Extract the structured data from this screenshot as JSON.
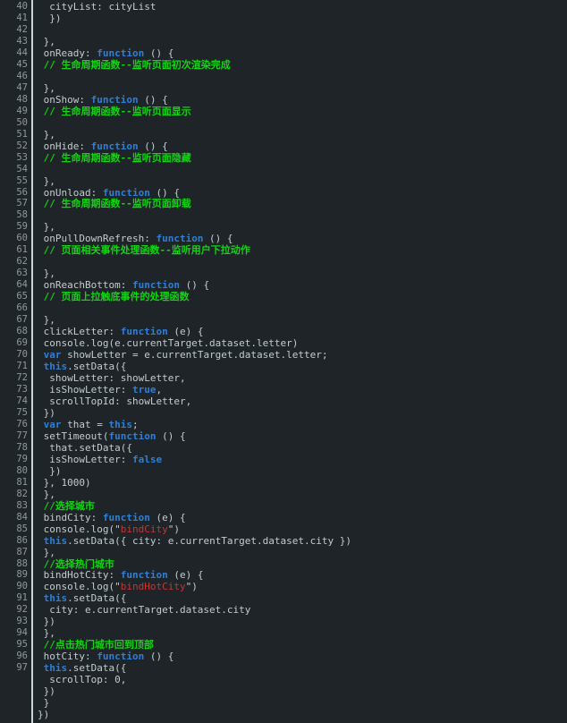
{
  "editor": {
    "theme_background": "#1e2427",
    "gutter_background": "#1e2427",
    "text_color": "#c3cdd0",
    "line_number_color": "#8d9a9d",
    "gutter_separator_color": "#c9d6d8",
    "scrollbar_thumb_color": "#8a9a9d",
    "accent_colors": {
      "keyword": "#2f7fd6",
      "comment": "#10d510",
      "string": "#cc3333"
    },
    "language": "JavaScript",
    "first_visible_line": 40,
    "last_numbered_line": 97
  },
  "lines": [
    {
      "n": "40",
      "tokens": [
        {
          "t": "  cityList: cityList",
          "c": ""
        }
      ]
    },
    {
      "n": "41",
      "tokens": [
        {
          "t": "  })",
          "c": ""
        }
      ]
    },
    {
      "n": "42",
      "tokens": [
        {
          "t": "",
          "c": ""
        }
      ]
    },
    {
      "n": "43",
      "tokens": [
        {
          "t": " },",
          "c": ""
        }
      ]
    },
    {
      "n": "44",
      "tokens": [
        {
          "t": " onReady: ",
          "c": ""
        },
        {
          "t": "function",
          "c": "kw"
        },
        {
          "t": " () {",
          "c": ""
        }
      ]
    },
    {
      "n": "45",
      "tokens": [
        {
          "t": " // 生命周期函数--监听页面初次渲染完成",
          "c": "cmt"
        }
      ]
    },
    {
      "n": "46",
      "tokens": [
        {
          "t": "",
          "c": ""
        }
      ]
    },
    {
      "n": "47",
      "tokens": [
        {
          "t": " },",
          "c": ""
        }
      ]
    },
    {
      "n": "48",
      "tokens": [
        {
          "t": " onShow: ",
          "c": ""
        },
        {
          "t": "function",
          "c": "kw"
        },
        {
          "t": " () {",
          "c": ""
        }
      ]
    },
    {
      "n": "49",
      "tokens": [
        {
          "t": " // 生命周期函数--监听页面显示",
          "c": "cmt"
        }
      ]
    },
    {
      "n": "50",
      "tokens": [
        {
          "t": "",
          "c": ""
        }
      ]
    },
    {
      "n": "51",
      "tokens": [
        {
          "t": " },",
          "c": ""
        }
      ]
    },
    {
      "n": "52",
      "tokens": [
        {
          "t": " onHide: ",
          "c": ""
        },
        {
          "t": "function",
          "c": "kw"
        },
        {
          "t": " () {",
          "c": ""
        }
      ]
    },
    {
      "n": "53",
      "tokens": [
        {
          "t": " // 生命周期函数--监听页面隐藏",
          "c": "cmt"
        }
      ]
    },
    {
      "n": "54",
      "tokens": [
        {
          "t": "",
          "c": ""
        }
      ]
    },
    {
      "n": "55",
      "tokens": [
        {
          "t": " },",
          "c": ""
        }
      ]
    },
    {
      "n": "56",
      "tokens": [
        {
          "t": " onUnload: ",
          "c": ""
        },
        {
          "t": "function",
          "c": "kw"
        },
        {
          "t": " () {",
          "c": ""
        }
      ]
    },
    {
      "n": "57",
      "tokens": [
        {
          "t": " // 生命周期函数--监听页面卸载",
          "c": "cmt"
        }
      ]
    },
    {
      "n": "58",
      "tokens": [
        {
          "t": "",
          "c": ""
        }
      ]
    },
    {
      "n": "59",
      "tokens": [
        {
          "t": " },",
          "c": ""
        }
      ]
    },
    {
      "n": "60",
      "tokens": [
        {
          "t": " onPullDownRefresh: ",
          "c": ""
        },
        {
          "t": "function",
          "c": "kw"
        },
        {
          "t": " () {",
          "c": ""
        }
      ]
    },
    {
      "n": "61",
      "tokens": [
        {
          "t": " // 页面相关事件处理函数--监听用户下拉动作",
          "c": "cmt"
        }
      ]
    },
    {
      "n": "62",
      "tokens": [
        {
          "t": "",
          "c": ""
        }
      ]
    },
    {
      "n": "63",
      "tokens": [
        {
          "t": " },",
          "c": ""
        }
      ]
    },
    {
      "n": "64",
      "tokens": [
        {
          "t": " onReachBottom: ",
          "c": ""
        },
        {
          "t": "function",
          "c": "kw"
        },
        {
          "t": " () {",
          "c": ""
        }
      ]
    },
    {
      "n": "65",
      "tokens": [
        {
          "t": " // 页面上拉触底事件的处理函数",
          "c": "cmt"
        }
      ]
    },
    {
      "n": "66",
      "tokens": [
        {
          "t": "",
          "c": ""
        }
      ]
    },
    {
      "n": "67",
      "tokens": [
        {
          "t": " },",
          "c": ""
        }
      ]
    },
    {
      "n": "68",
      "tokens": [
        {
          "t": " clickLetter: ",
          "c": ""
        },
        {
          "t": "function",
          "c": "kw"
        },
        {
          "t": " (e) {",
          "c": ""
        }
      ]
    },
    {
      "n": "69",
      "tokens": [
        {
          "t": " console.log(e.currentTarget.dataset.letter)",
          "c": ""
        }
      ]
    },
    {
      "n": "70",
      "tokens": [
        {
          "t": " ",
          "c": ""
        },
        {
          "t": "var",
          "c": "kw"
        },
        {
          "t": " showLetter = e.currentTarget.dataset.letter;",
          "c": ""
        }
      ]
    },
    {
      "n": "71",
      "tokens": [
        {
          "t": " ",
          "c": ""
        },
        {
          "t": "this",
          "c": "kw"
        },
        {
          "t": ".setData({",
          "c": ""
        }
      ]
    },
    {
      "n": "72",
      "tokens": [
        {
          "t": "  showLetter: showLetter,",
          "c": ""
        }
      ]
    },
    {
      "n": "73",
      "tokens": [
        {
          "t": "  isShowLetter: ",
          "c": ""
        },
        {
          "t": "true",
          "c": "kw"
        },
        {
          "t": ",",
          "c": ""
        }
      ]
    },
    {
      "n": "74",
      "tokens": [
        {
          "t": "  scrollTopId: showLetter,",
          "c": ""
        }
      ]
    },
    {
      "n": "75",
      "tokens": [
        {
          "t": " })",
          "c": ""
        }
      ]
    },
    {
      "n": "76",
      "tokens": [
        {
          "t": " ",
          "c": ""
        },
        {
          "t": "var",
          "c": "kw"
        },
        {
          "t": " that = ",
          "c": ""
        },
        {
          "t": "this",
          "c": "kw"
        },
        {
          "t": ";",
          "c": ""
        }
      ]
    },
    {
      "n": "77",
      "tokens": [
        {
          "t": " setTimeout(",
          "c": ""
        },
        {
          "t": "function",
          "c": "kw"
        },
        {
          "t": " () {",
          "c": ""
        }
      ]
    },
    {
      "n": "78",
      "tokens": [
        {
          "t": "  that.setData({",
          "c": ""
        }
      ]
    },
    {
      "n": "79",
      "tokens": [
        {
          "t": "  isShowLetter: ",
          "c": ""
        },
        {
          "t": "false",
          "c": "kw"
        }
      ]
    },
    {
      "n": "80",
      "tokens": [
        {
          "t": "  })",
          "c": ""
        }
      ]
    },
    {
      "n": "81",
      "tokens": [
        {
          "t": " }, 1000)",
          "c": ""
        }
      ]
    },
    {
      "n": "82",
      "tokens": [
        {
          "t": " },",
          "c": ""
        }
      ]
    },
    {
      "n": "83",
      "tokens": [
        {
          "t": " //选择城市",
          "c": "cmt"
        }
      ]
    },
    {
      "n": "84",
      "tokens": [
        {
          "t": " bindCity: ",
          "c": ""
        },
        {
          "t": "function",
          "c": "kw"
        },
        {
          "t": " (e) {",
          "c": ""
        }
      ]
    },
    {
      "n": "85",
      "tokens": [
        {
          "t": " console.log(",
          "c": ""
        },
        {
          "t": "\"",
          "c": "q"
        },
        {
          "t": "bindCity",
          "c": "str"
        },
        {
          "t": "\"",
          "c": "q"
        },
        {
          "t": ")",
          "c": ""
        }
      ]
    },
    {
      "n": "86",
      "tokens": [
        {
          "t": " ",
          "c": ""
        },
        {
          "t": "this",
          "c": "kw"
        },
        {
          "t": ".setData({ city: e.currentTarget.dataset.city })",
          "c": ""
        }
      ]
    },
    {
      "n": "87",
      "tokens": [
        {
          "t": " },",
          "c": ""
        }
      ]
    },
    {
      "n": "88",
      "tokens": [
        {
          "t": " //选择热门城市",
          "c": "cmt"
        }
      ]
    },
    {
      "n": "89",
      "tokens": [
        {
          "t": " bindHotCity: ",
          "c": ""
        },
        {
          "t": "function",
          "c": "kw"
        },
        {
          "t": " (e) {",
          "c": ""
        }
      ]
    },
    {
      "n": "90",
      "tokens": [
        {
          "t": " console.log(",
          "c": ""
        },
        {
          "t": "\"",
          "c": "q"
        },
        {
          "t": "bindHotCity",
          "c": "str"
        },
        {
          "t": "\"",
          "c": "q"
        },
        {
          "t": ")",
          "c": ""
        }
      ]
    },
    {
      "n": "91",
      "tokens": [
        {
          "t": " ",
          "c": ""
        },
        {
          "t": "this",
          "c": "kw"
        },
        {
          "t": ".setData({",
          "c": ""
        }
      ]
    },
    {
      "n": "92",
      "tokens": [
        {
          "t": "  city: e.currentTarget.dataset.city",
          "c": ""
        }
      ]
    },
    {
      "n": "93",
      "tokens": [
        {
          "t": " })",
          "c": ""
        }
      ]
    },
    {
      "n": "94",
      "tokens": [
        {
          "t": " },",
          "c": ""
        }
      ]
    },
    {
      "n": "95",
      "tokens": [
        {
          "t": " //点击热门城市回到顶部",
          "c": "cmt"
        }
      ]
    },
    {
      "n": "96",
      "tokens": [
        {
          "t": " hotCity: ",
          "c": ""
        },
        {
          "t": "function",
          "c": "kw"
        },
        {
          "t": " () {",
          "c": ""
        }
      ]
    },
    {
      "n": "97",
      "tokens": [
        {
          "t": " ",
          "c": ""
        },
        {
          "t": "this",
          "c": "kw"
        },
        {
          "t": ".setData({",
          "c": ""
        }
      ]
    },
    {
      "n": "",
      "tokens": [
        {
          "t": "  scrollTop: 0,",
          "c": ""
        }
      ]
    },
    {
      "n": "",
      "tokens": [
        {
          "t": " })",
          "c": ""
        }
      ]
    },
    {
      "n": "",
      "tokens": [
        {
          "t": " }",
          "c": ""
        }
      ]
    },
    {
      "n": "",
      "tokens": [
        {
          "t": "})",
          "c": ""
        }
      ]
    }
  ]
}
